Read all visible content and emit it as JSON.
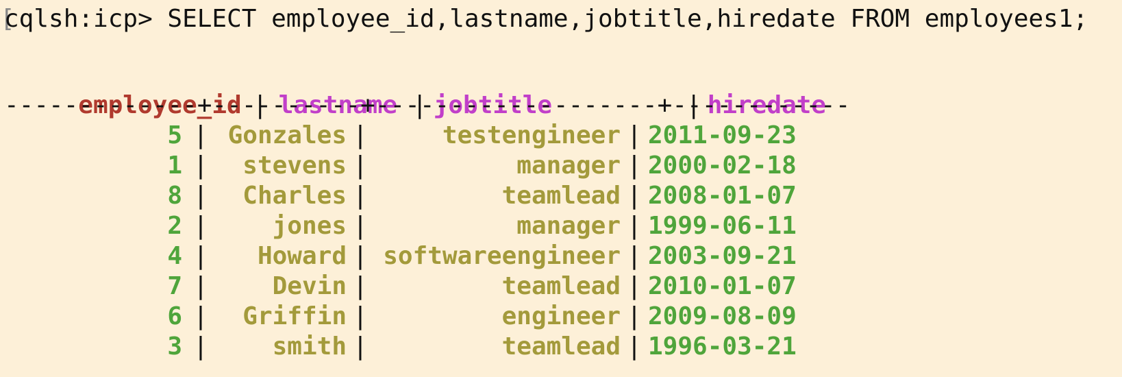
{
  "prompt": {
    "text": "cqlsh:icp> SELECT employee_id,lastname,jobtitle,hiredate FROM employees1;"
  },
  "table": {
    "headers": {
      "employee_id": "employee_id",
      "lastname": "lastname",
      "jobtitle": "jobtitle",
      "hiredate": "hiredate"
    },
    "separator": "-------------+----------+-------------------+------------",
    "rows": [
      {
        "employee_id": "5",
        "lastname": "Gonzales",
        "jobtitle": "testengineer",
        "hiredate": "2011-09-23"
      },
      {
        "employee_id": "1",
        "lastname": "stevens",
        "jobtitle": "manager",
        "hiredate": "2000-02-18"
      },
      {
        "employee_id": "8",
        "lastname": "Charles",
        "jobtitle": "teamlead",
        "hiredate": "2008-01-07"
      },
      {
        "employee_id": "2",
        "lastname": "jones",
        "jobtitle": "manager",
        "hiredate": "1999-06-11"
      },
      {
        "employee_id": "4",
        "lastname": "Howard",
        "jobtitle": "softwareengineer",
        "hiredate": "2003-09-21"
      },
      {
        "employee_id": "7",
        "lastname": "Devin",
        "jobtitle": "teamlead",
        "hiredate": "2010-01-07"
      },
      {
        "employee_id": "6",
        "lastname": "Griffin",
        "jobtitle": "engineer",
        "hiredate": "2009-08-09"
      },
      {
        "employee_id": "3",
        "lastname": "smith",
        "jobtitle": "teamlead",
        "hiredate": "1996-03-21"
      }
    ]
  },
  "colors": {
    "background": "#fdf0d8",
    "primary_key_header": "#b03a2e",
    "column_header": "#c13fc9",
    "numeric_value": "#4fa53b",
    "text_value": "#a39a3b"
  }
}
